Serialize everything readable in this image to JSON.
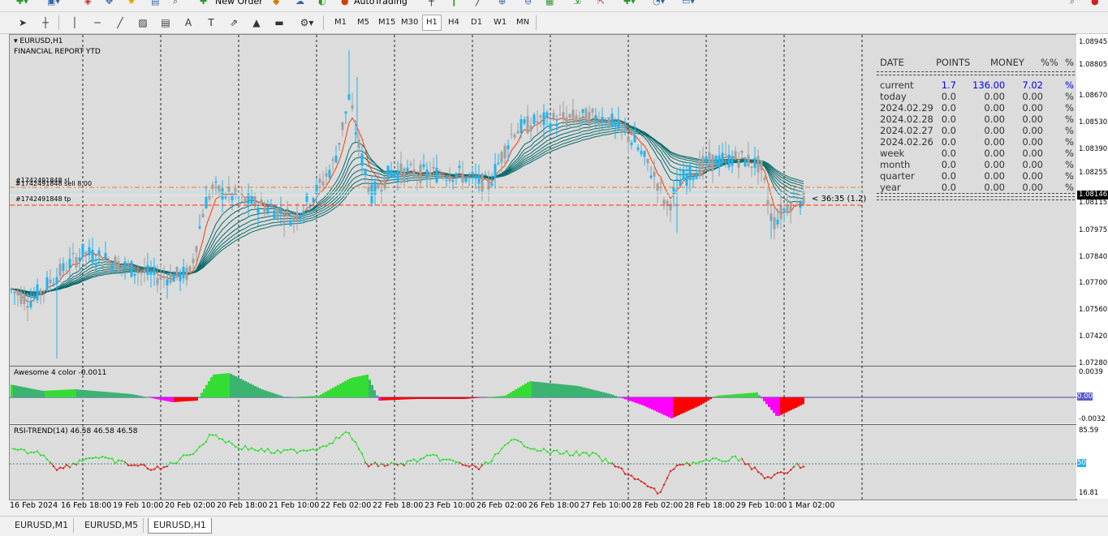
{
  "toolbar_top": {
    "new_order": "New Order",
    "autotrading": "AutoTrading"
  },
  "timeframes": [
    "M1",
    "M5",
    "M15",
    "M30",
    "H1",
    "H4",
    "D1",
    "W1",
    "MN"
  ],
  "active_timeframe": "H1",
  "chart": {
    "symbol_title": "EURUSD,H1",
    "subtitle": "FINANCIAL REPORT YTD",
    "order_labels": {
      "sl": "#1742491848 sl",
      "sell": "#1742491848 sell 8.00",
      "tp": "#1742491848 tp"
    },
    "countdown": "< 36:35 (1.2)",
    "current_price": "1.08146",
    "price_ticks": [
      "1.08945",
      "1.08805",
      "1.08670",
      "1.08530",
      "1.08390",
      "1.08255",
      "1.08115",
      "1.07975",
      "1.07840",
      "1.07700",
      "1.07560",
      "1.07420",
      "1.07280"
    ],
    "time_labels": [
      "16 Feb 2024",
      "16 Feb 18:00",
      "19 Feb 10:00",
      "20 Feb 02:00",
      "20 Feb 18:00",
      "21 Feb 10:00",
      "22 Feb 02:00",
      "22 Feb 18:00",
      "23 Feb 10:00",
      "26 Feb 02:00",
      "26 Feb 18:00",
      "27 Feb 10:00",
      "28 Feb 02:00",
      "28 Feb 18:00",
      "29 Feb 10:00",
      "1 Mar 02:00"
    ]
  },
  "report": {
    "headers": [
      "DATE",
      "POINTS",
      "MONEY",
      "%%",
      "%"
    ],
    "rows": [
      {
        "date": "current",
        "points": "1.7",
        "money": "136.00",
        "pct": "7.02",
        "sym": "%"
      },
      {
        "date": "today",
        "points": "0.0",
        "money": "0.00",
        "pct": "0.00",
        "sym": "%"
      },
      {
        "date": "2024.02.29",
        "points": "0.0",
        "money": "0.00",
        "pct": "0.00",
        "sym": "%"
      },
      {
        "date": "2024.02.28",
        "points": "0.0",
        "money": "0.00",
        "pct": "0.00",
        "sym": "%"
      },
      {
        "date": "2024.02.27",
        "points": "0.0",
        "money": "0.00",
        "pct": "0.00",
        "sym": "%"
      },
      {
        "date": "2024.02.26",
        "points": "0.0",
        "money": "0.00",
        "pct": "0.00",
        "sym": "%"
      },
      {
        "date": "week",
        "points": "0.0",
        "money": "0.00",
        "pct": "0.00",
        "sym": "%"
      },
      {
        "date": "month",
        "points": "0.0",
        "money": "0.00",
        "pct": "0.00",
        "sym": "%"
      },
      {
        "date": "quarter",
        "points": "0.0",
        "money": "0.00",
        "pct": "0.00",
        "sym": "%"
      },
      {
        "date": "year",
        "points": "0.0",
        "money": "0.00",
        "pct": "0.00",
        "sym": "%"
      }
    ]
  },
  "ao": {
    "title": "Awesome 4 color -0.0011",
    "ticks": [
      "0.0039",
      "0.00",
      "-0.0032"
    ]
  },
  "rsi": {
    "title": "RSI-TREND(14) 46.58 46.58 46.58",
    "ticks": [
      "85.59",
      "50",
      "16.81"
    ]
  },
  "tabs": [
    "EURUSD,M1",
    "EURUSD,M5",
    "EURUSD,H1"
  ],
  "active_tab": "EURUSD,H1",
  "colors": {
    "chart_bg": "#dcdcdc",
    "bull": "#1eb4f0",
    "bear": "#a0a0a0",
    "ma_fast": "#ff3b00",
    "ma_slow": "#0a6a6a",
    "ao_up": "#3cb371",
    "ao_down": "#ff00ff",
    "rsi_up": "#33dd33",
    "rsi_down": "#dd2222"
  }
}
